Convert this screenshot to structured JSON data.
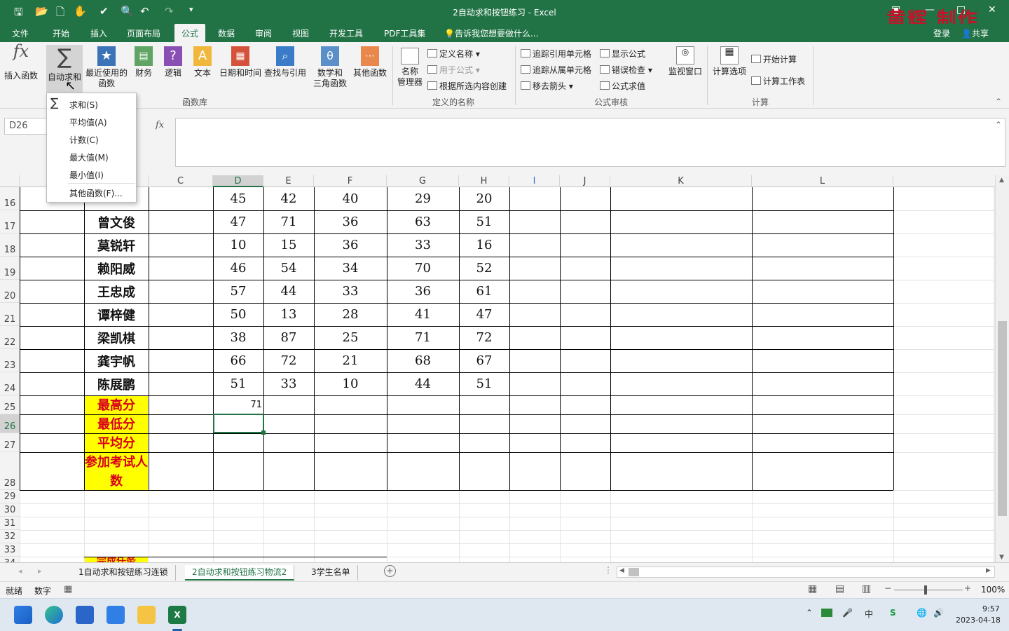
{
  "title": "2自动求和按钮练习 - Excel",
  "watermark": "黄辉 制作",
  "account": {
    "login": "登录",
    "share": "共享"
  },
  "menu": {
    "file": "文件",
    "home": "开始",
    "insert": "插入",
    "layout": "页面布局",
    "formula": "公式",
    "data": "数据",
    "review": "审阅",
    "view": "视图",
    "dev": "开发工具",
    "pdf": "PDF工具集",
    "tell": "告诉我您想要做什么..."
  },
  "ribbon": {
    "insert_fn": "插入函数",
    "autosum": "自动求和",
    "recent": "最近使用的",
    "recent2": "函数",
    "finance": "财务",
    "logic": "逻辑",
    "text": "文本",
    "datetime": "日期和时间",
    "lookup": "查找与引用",
    "math": "数学和",
    "math2": "三角函数",
    "other": "其他函数",
    "library": "函数库",
    "name_mgr": "名称",
    "name_mgr2": "管理器",
    "define_name": "定义名称",
    "use_formula": "用于公式",
    "create_sel": "根据所选内容创建",
    "defined_names": "定义的名称",
    "trace_prec": "追踪引用单元格",
    "trace_dep": "追踪从属单元格",
    "remove_arrows": "移去箭头",
    "show_formulas": "显示公式",
    "error_check": "错误检查",
    "eval_formula": "公式求值",
    "audit": "公式审核",
    "watch": "监视窗口",
    "calc_opts": "计算选项",
    "calc_now": "开始计算",
    "calc_sheet": "计算工作表",
    "calc": "计算"
  },
  "dropdown": [
    "求和(S)",
    "平均值(A)",
    "计数(C)",
    "最大值(M)",
    "最小值(I)",
    "其他函数(F)..."
  ],
  "namebox": "D26",
  "fx": "fx",
  "columns": [
    "C",
    "D",
    "E",
    "F",
    "G",
    "H",
    "I",
    "J",
    "K",
    "L"
  ],
  "rows": [
    {
      "n": "16",
      "name": "",
      "vals": [
        "45",
        "42",
        "40",
        "29",
        "20"
      ]
    },
    {
      "n": "17",
      "name": "曾文俊",
      "vals": [
        "47",
        "71",
        "36",
        "63",
        "51"
      ]
    },
    {
      "n": "18",
      "name": "莫锐轩",
      "vals": [
        "10",
        "15",
        "36",
        "33",
        "16"
      ]
    },
    {
      "n": "19",
      "name": "赖阳威",
      "vals": [
        "46",
        "54",
        "34",
        "70",
        "52"
      ]
    },
    {
      "n": "20",
      "name": "王忠成",
      "vals": [
        "57",
        "44",
        "33",
        "36",
        "61"
      ]
    },
    {
      "n": "21",
      "name": "谭梓健",
      "vals": [
        "50",
        "13",
        "28",
        "41",
        "47"
      ]
    },
    {
      "n": "22",
      "name": "梁凯棋",
      "vals": [
        "38",
        "87",
        "25",
        "71",
        "72"
      ]
    },
    {
      "n": "23",
      "name": "龚宇帆",
      "vals": [
        "66",
        "72",
        "21",
        "68",
        "67"
      ]
    },
    {
      "n": "24",
      "name": "陈展鹏",
      "vals": [
        "51",
        "33",
        "10",
        "44",
        "51"
      ]
    }
  ],
  "summary": [
    "最高分",
    "最低分",
    "平均分",
    "参加考试人数"
  ],
  "summary_rows": [
    "25",
    "26",
    "27",
    "28"
  ],
  "max_value": "71",
  "extra_rows": [
    "29",
    "30",
    "31",
    "32",
    "33"
  ],
  "partial_label": "完成任务",
  "sheets": [
    "1自动求和按钮练习连锁",
    "2自动求和按钮练习物流2",
    "3学生名单"
  ],
  "status": {
    "ready": "就绪",
    "mode": "数字",
    "zoom": "100%"
  },
  "clock": {
    "time": "9:57",
    "date": "2023-04-18"
  }
}
